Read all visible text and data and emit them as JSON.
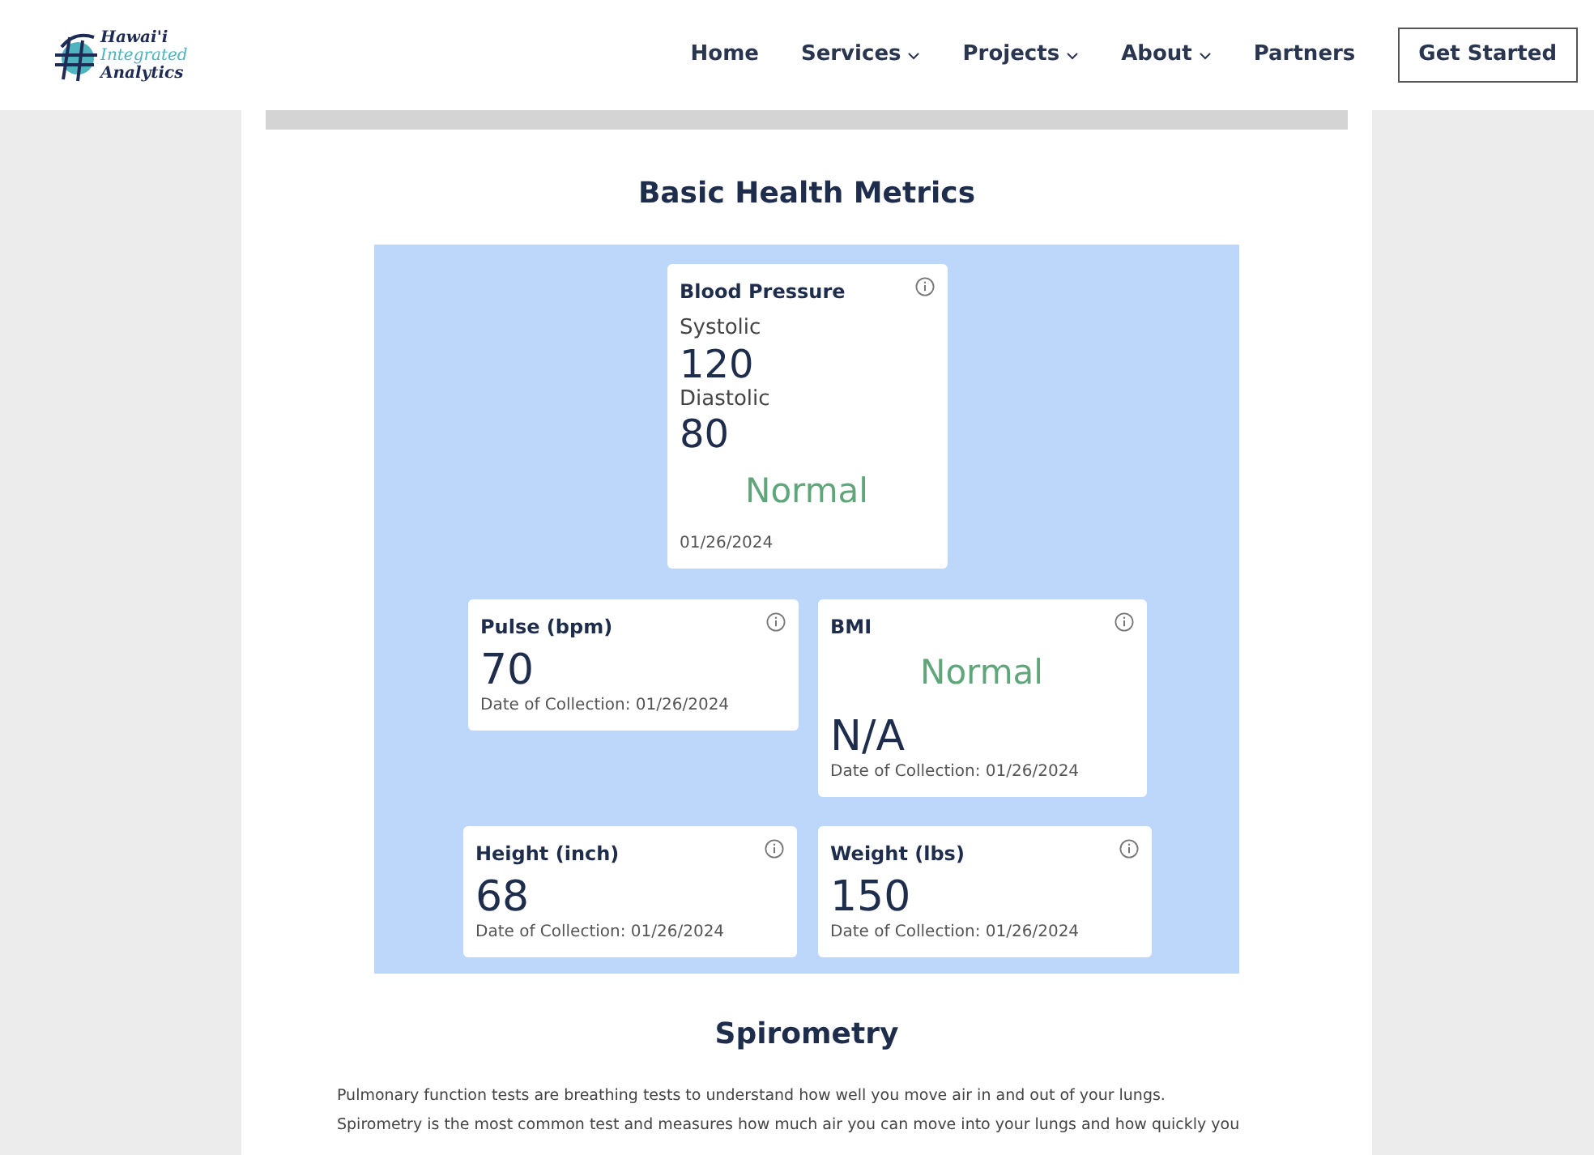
{
  "logo": {
    "line_1": "Hawai'i",
    "line_2": "Integrated",
    "line_3": "Analytics"
  },
  "nav": [
    {
      "label": "Home",
      "dropdown": false
    },
    {
      "label": "Services",
      "dropdown": true
    },
    {
      "label": "Projects",
      "dropdown": true
    },
    {
      "label": "About",
      "dropdown": true
    },
    {
      "label": "Partners",
      "dropdown": false
    }
  ],
  "cta": "Get Started",
  "metrics": {
    "title": "Basic Health Metrics",
    "blood_pressure": {
      "title": "Blood Pressure",
      "systolic_label": "Systolic",
      "systolic": "120",
      "diastolic_label": "Diastolic",
      "diastolic": "80",
      "status": "Normal",
      "date": "01/26/2024"
    },
    "pulse": {
      "title": "Pulse (bpm)",
      "value": "70",
      "date": "Date of Collection: 01/26/2024"
    },
    "bmi": {
      "title": "BMI",
      "status": "Normal",
      "value": "N/A",
      "date": "Date of Collection: 01/26/2024"
    },
    "height": {
      "title": "Height (inch)",
      "value": "68",
      "date": "Date of Collection: 01/26/2024"
    },
    "weight": {
      "title": "Weight (lbs)",
      "value": "150",
      "date": "Date of Collection: 01/26/2024"
    }
  },
  "spirometry": {
    "title": "Spirometry",
    "lines": [
      "Pulmonary function tests are breathing tests to understand how well you move air in and out of your lungs.",
      "Spirometry is the most common test and measures how much air you can move into your lungs and how quickly you"
    ]
  }
}
